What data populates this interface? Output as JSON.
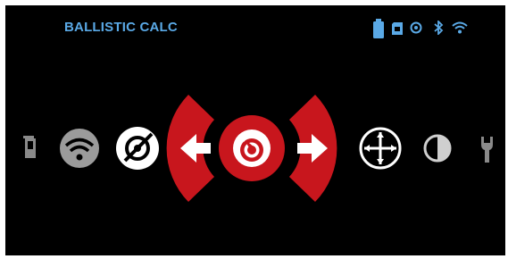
{
  "header": {
    "title": "BALLISTIC CALC"
  },
  "status_bar": {
    "icons": [
      "battery-icon",
      "sd-card-icon",
      "timer-icon",
      "bluetooth-icon",
      "wifi-icon"
    ],
    "accent_color": "#5aa9e6"
  },
  "menu": {
    "items": [
      {
        "name": "gallery",
        "icon": "gallery-icon"
      },
      {
        "name": "wifi",
        "icon": "wifi-icon"
      },
      {
        "name": "ballistic-off",
        "icon": "ballistic-off-icon"
      },
      {
        "name": "previous",
        "icon": "arrow-left-icon"
      },
      {
        "name": "ballistic-calc",
        "icon": "ballistic-target-icon",
        "selected": true
      },
      {
        "name": "next",
        "icon": "arrow-right-icon"
      },
      {
        "name": "reticle",
        "icon": "crosshair-icon"
      },
      {
        "name": "brightness",
        "icon": "contrast-icon"
      },
      {
        "name": "tools",
        "icon": "wrench-icon"
      }
    ],
    "selected_color": "#c8161d"
  }
}
